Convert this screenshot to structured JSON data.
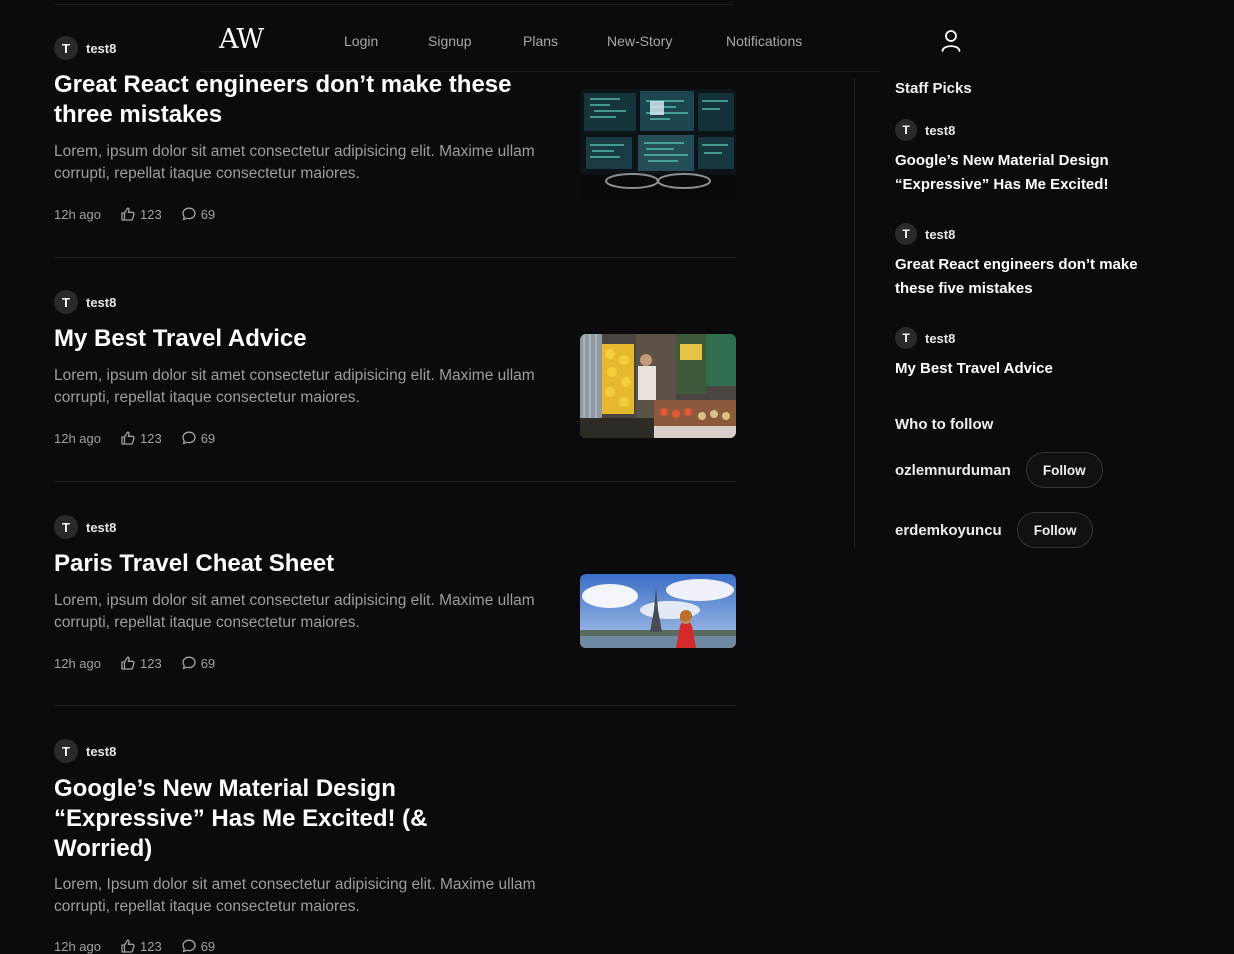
{
  "nav": {
    "brand": "AW",
    "links": [
      "Login",
      "Signup",
      "Plans",
      "New-Story",
      "Notifications"
    ],
    "profile_icon": "user-icon"
  },
  "articles": [
    {
      "author_initial": "T",
      "author": "test8",
      "title": "Great React engineers don’t make these three mistakes",
      "excerpt": "Lorem, ipsum dolor sit amet consectetur adipisicing elit. Maxime ullam corrupti, repellat itaque consectetur maiores.",
      "time": "12h ago",
      "likes": "123",
      "comments": "69",
      "thumb": "code-screens-image"
    },
    {
      "author_initial": "T",
      "author": "test8",
      "title": "My Best Travel Advice",
      "excerpt": "Lorem, ipsum dolor sit amet consectetur adipisicing elit. Maxime ullam corrupti, repellat itaque consectetur maiores.",
      "time": "12h ago",
      "likes": "123",
      "comments": "69",
      "thumb": "market-stall-image"
    },
    {
      "author_initial": "T",
      "author": "test8",
      "title": "Paris Travel Cheat Sheet",
      "excerpt": "Lorem, ipsum dolor sit amet consectetur adipisicing elit. Maxime ullam corrupti, repellat itaque consectetur maiores.",
      "time": "12h ago",
      "likes": "123",
      "comments": "69",
      "thumb": "eiffel-tower-image"
    },
    {
      "author_initial": "T",
      "author": "test8",
      "title": "Google’s New Material Design “Expressive” Has Me Excited! (& Worried)",
      "excerpt": "Lorem, Ipsum dolor sit amet consectetur adipisicing elit. Maxime ullam corrupti, repellat itaque consectetur maiores.",
      "time": "12h ago",
      "likes": "123",
      "comments": "69"
    }
  ],
  "sidebar": {
    "staff_picks_heading": "Staff Picks",
    "picks": [
      {
        "author_initial": "T",
        "author": "test8",
        "title": "Google’s New Material Design “Expressive” Has Me Excited!"
      },
      {
        "author_initial": "T",
        "author": "test8",
        "title": "Great React engineers don’t make these five mistakes"
      },
      {
        "author_initial": "T",
        "author": "test8",
        "title": "My Best Travel Advice"
      }
    ],
    "who_to_follow_heading": "Who to follow",
    "follow": [
      {
        "name": "ozlemnurduman",
        "button": "Follow"
      },
      {
        "name": "erdemkoyuncu",
        "button": "Follow"
      }
    ]
  },
  "colors": {
    "background": "#0b0b0d",
    "text": "#ffffff",
    "muted": "#9c9ca3",
    "divider": "#1f1f23"
  }
}
